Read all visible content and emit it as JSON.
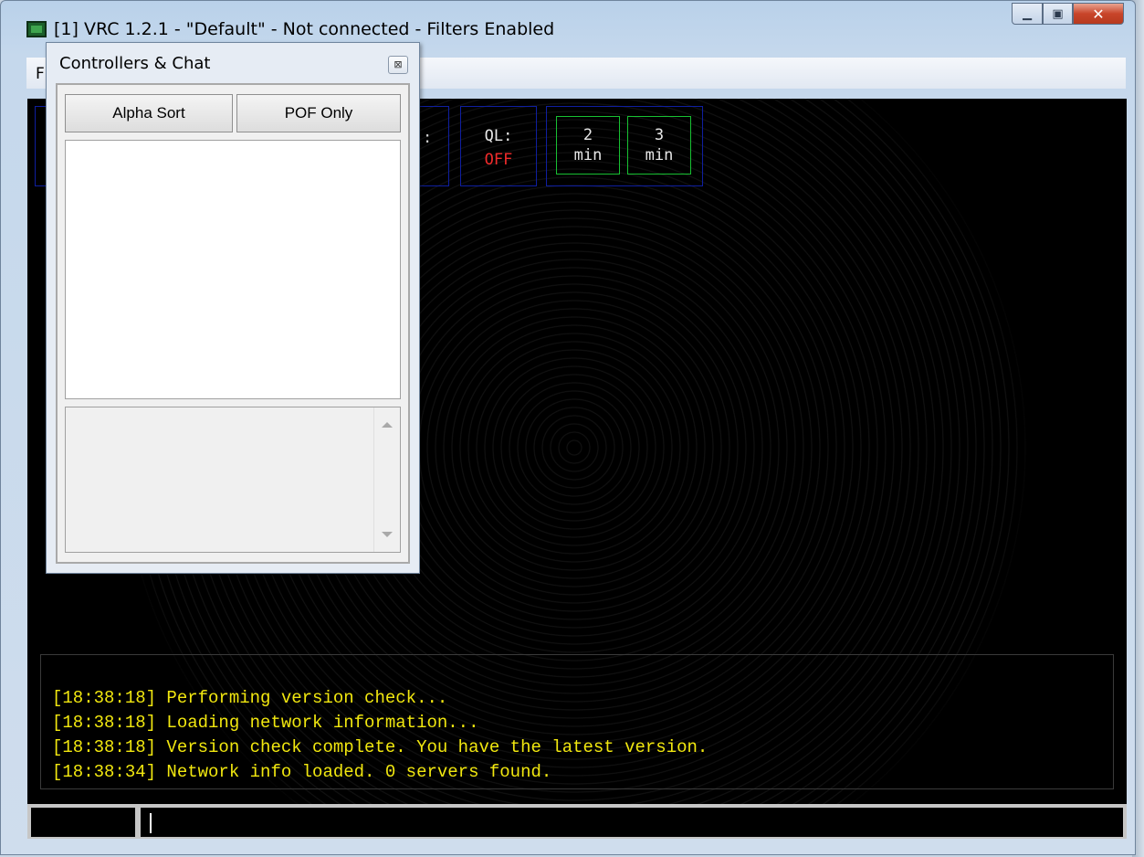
{
  "window": {
    "title": "[1] VRC 1.2.1 - \"Default\" - Not connected - Filters Enabled",
    "menu_first": "F"
  },
  "controllers_chat": {
    "title": "Controllers & Chat",
    "close_glyph": "⊠",
    "alpha_sort_label": "Alpha Sort",
    "pof_only_label": "POF Only"
  },
  "radar": {
    "hidden_box_text": ":",
    "ql_label": "QL:",
    "ql_value": "OFF",
    "timer_2": {
      "number": "2",
      "unit": "min"
    },
    "timer_3": {
      "number": "3",
      "unit": "min"
    }
  },
  "log": [
    "[18:38:18] Performing version check...",
    "[18:38:18] Loading network information...",
    "[18:38:18] Version check complete. You have the latest version.",
    "[18:38:34] Network info loaded. 0 servers found."
  ],
  "colors": {
    "log_text": "#f1e70f",
    "ql_off": "#f12b2b",
    "timer_border": "#18c032",
    "box_border": "#0f1fa0"
  }
}
